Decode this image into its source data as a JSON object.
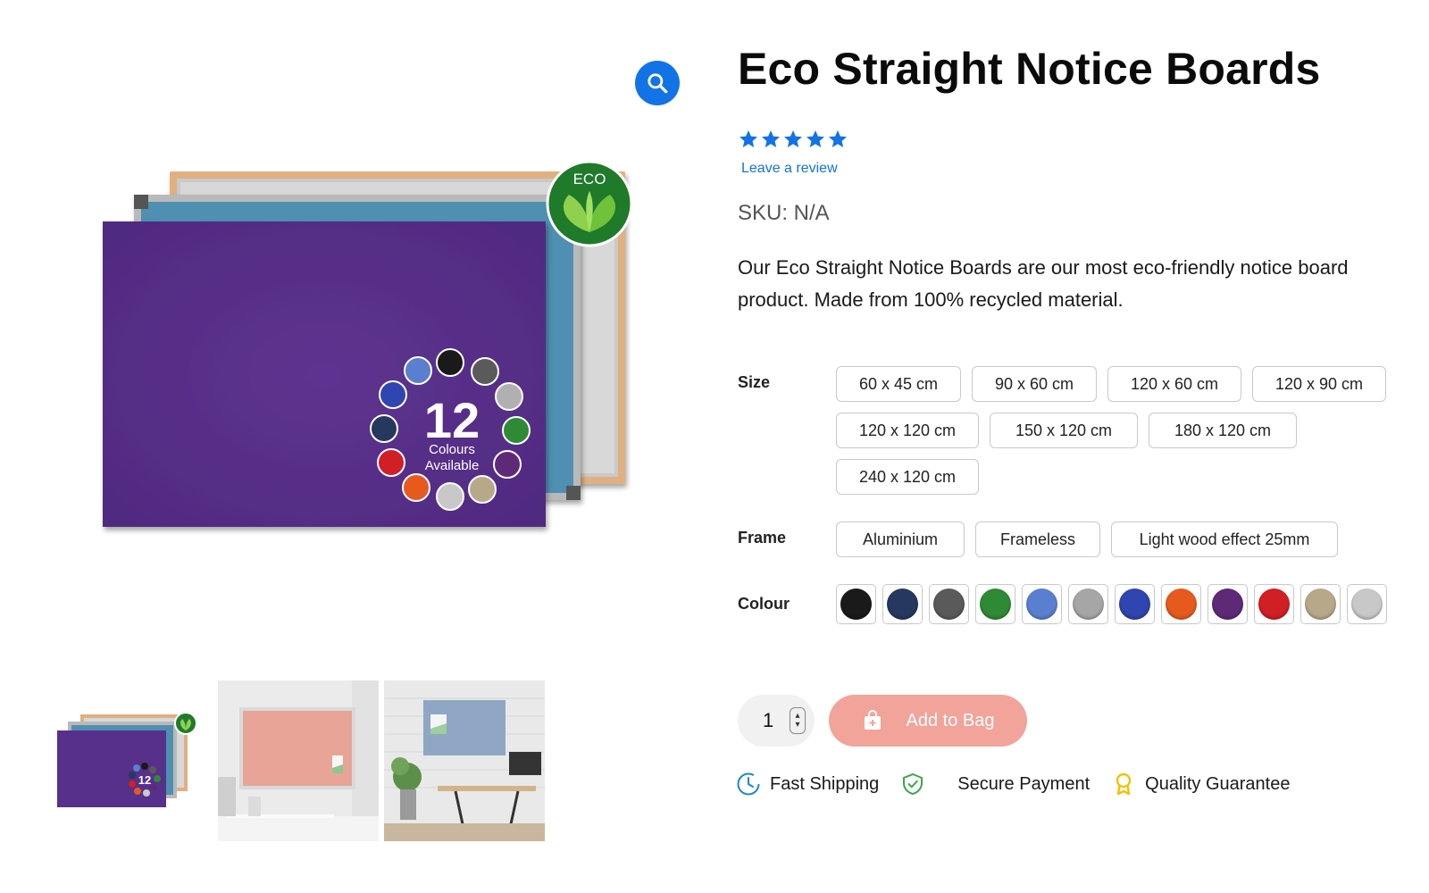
{
  "product": {
    "title": "Eco Straight Notice Boards",
    "rating": 5,
    "review_link": "Leave a review",
    "sku": "SKU: N/A",
    "description": "Our Eco Straight Notice Boards are our most eco-friendly notice board product. Made from 100% recycled material."
  },
  "gallery": {
    "eco_badge": "ECO",
    "colours_count": "12",
    "colours_word": "Colours",
    "available_word": "Available",
    "thumb_count_label": "12"
  },
  "options": {
    "size": {
      "label": "Size",
      "values": [
        "60 x 45 cm",
        "90 x 60 cm",
        "120 x 60 cm",
        "120 x 90 cm",
        "120 x 120 cm",
        "150 x 120 cm",
        "180 x 120 cm",
        "240 x 120 cm"
      ]
    },
    "frame": {
      "label": "Frame",
      "values": [
        "Aluminium",
        "Frameless",
        "Light wood effect 25mm"
      ]
    },
    "colour": {
      "label": "Colour",
      "swatches": [
        "#1a1a1a",
        "#27385f",
        "#5a5a5a",
        "#2f8a35",
        "#5a7fd0",
        "#a6a6a6",
        "#2f46b0",
        "#e65a1e",
        "#5e2a78",
        "#d11f26",
        "#b8a88a",
        "#c8c8c8"
      ]
    }
  },
  "cart": {
    "quantity": "1",
    "add_label": "Add to Bag",
    "button_color": "#f2a39a"
  },
  "features": {
    "shipping": "Fast Shipping",
    "payment": "Secure Payment",
    "guarantee": "Quality Guarantee"
  },
  "colors": {
    "accent": "#1273e6",
    "board_purple": "#5a2f8c"
  }
}
